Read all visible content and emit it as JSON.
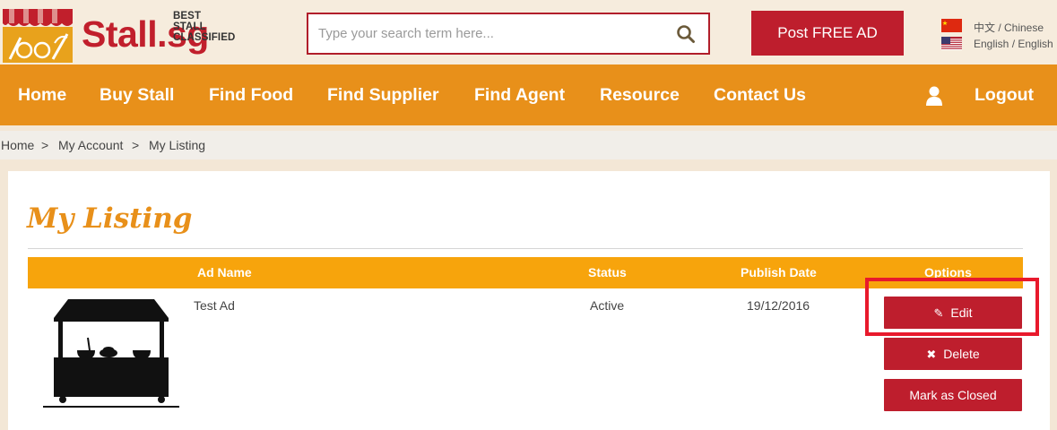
{
  "brand": {
    "name": "Stall.sg",
    "tagline": "BEST STALL CLASSIFIED",
    "primary_color": "#be1e2d",
    "accent_color": "#e8901a"
  },
  "search": {
    "placeholder": "Type your search term here...",
    "value": ""
  },
  "header": {
    "post_button": "Post FREE AD",
    "languages": [
      {
        "label": "中文 / Chinese",
        "icon": "china-flag-icon"
      },
      {
        "label": "English / English",
        "icon": "us-flag-icon"
      }
    ]
  },
  "nav": {
    "items": [
      {
        "label": "Home"
      },
      {
        "label": "Buy Stall"
      },
      {
        "label": "Find Food"
      },
      {
        "label": "Find Supplier"
      },
      {
        "label": "Find Agent"
      },
      {
        "label": "Resource"
      },
      {
        "label": "Contact Us"
      }
    ],
    "user_icon": "user-icon",
    "logout": "Logout"
  },
  "breadcrumb": {
    "items": [
      "Home",
      "My Account",
      "My Listing"
    ],
    "separator": ">"
  },
  "page": {
    "title": "My Listing"
  },
  "table": {
    "headers": [
      "Ad Name",
      "Status",
      "Publish Date",
      "Options"
    ],
    "rows": [
      {
        "ad_name": "Test Ad",
        "status": "Active",
        "publish_date": "19/12/2016",
        "image_icon": "food-stall-icon"
      }
    ],
    "options": {
      "edit": "Edit",
      "delete": "Delete",
      "mark_closed": "Mark as Closed"
    }
  }
}
